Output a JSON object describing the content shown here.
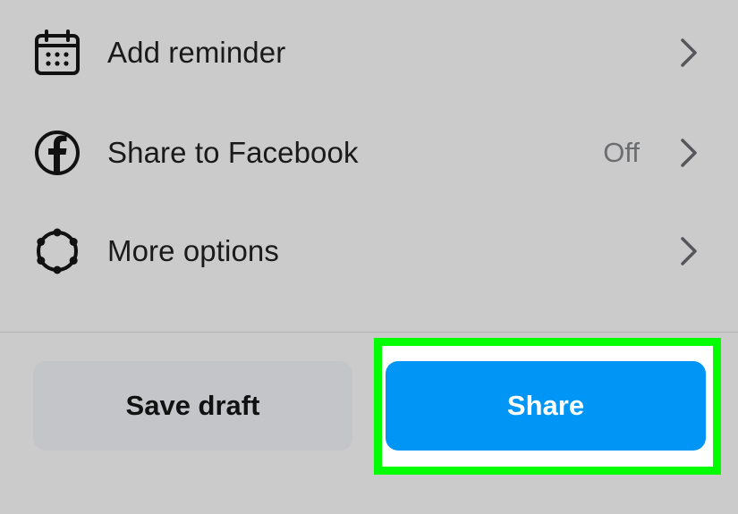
{
  "menu": {
    "items": [
      {
        "label": "Add reminder",
        "value": "",
        "icon": "calendar-icon"
      },
      {
        "label": "Share to Facebook",
        "value": "Off",
        "icon": "facebook-icon"
      },
      {
        "label": "More options",
        "value": "",
        "icon": "gear-icon"
      }
    ]
  },
  "actions": {
    "save_draft_label": "Save draft",
    "share_label": "Share"
  },
  "colors": {
    "background": "#cbcbcb",
    "share_button": "#0195f5",
    "draft_button": "#c3c5c8",
    "highlight": "#00ff00"
  }
}
